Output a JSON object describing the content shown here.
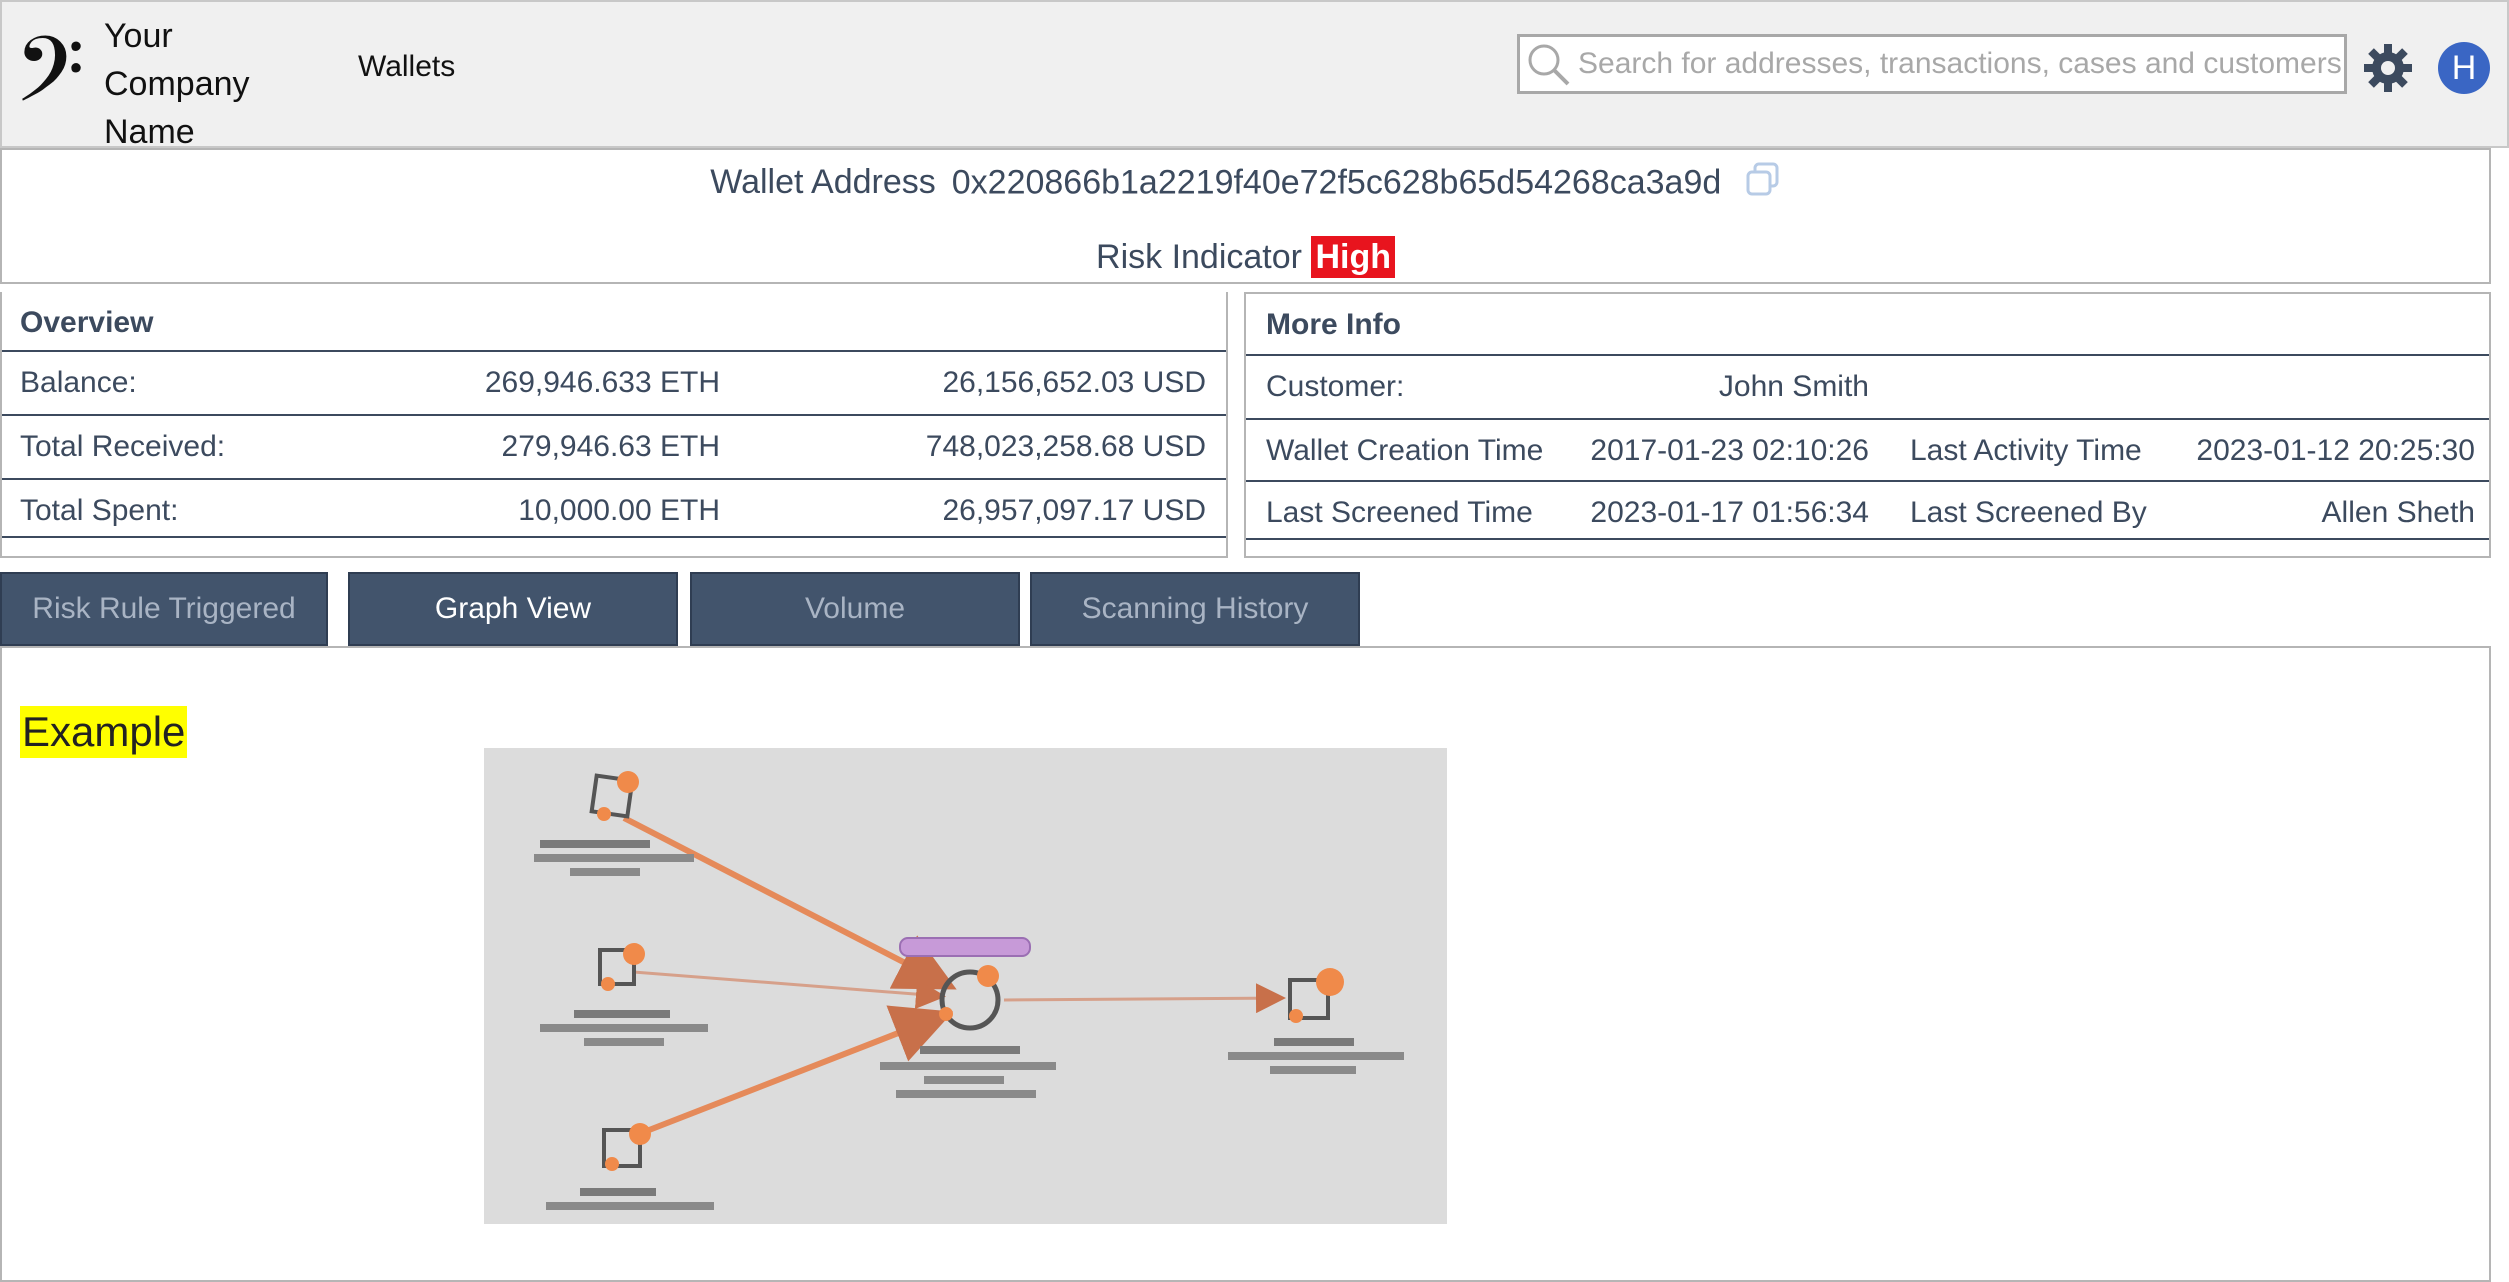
{
  "header": {
    "company_name": "Your Company Name",
    "nav_wallets": "Wallets",
    "search_placeholder": "Search for addresses, transactions, cases and customers...",
    "avatar_initial": "H"
  },
  "wallet": {
    "address_label": "Wallet Address",
    "address": "0x220866b1a2219f40e72f5c628b65d54268ca3a9d",
    "risk_label": "Risk Indicator",
    "risk_value": "High",
    "risk_color": "#e8141e"
  },
  "overview": {
    "title": "Overview",
    "rows": [
      {
        "label": "Balance:",
        "eth": "269,946.633 ETH",
        "usd": "26,156,652.03 USD"
      },
      {
        "label": "Total Received:",
        "eth": "279,946.63 ETH",
        "usd": "748,023,258.68 USD"
      },
      {
        "label": "Total Spent:",
        "eth": "10,000.00 ETH",
        "usd": "26,957,097.17 USD"
      }
    ]
  },
  "more_info": {
    "title": "More Info",
    "customer_label": "Customer:",
    "customer_value": "John Smith",
    "creation_label": "Wallet Creation Time",
    "creation_value": "2017-01-23 02:10:26",
    "last_activity_label": "Last Activity Time",
    "last_activity_value": "2023-01-12 20:25:30",
    "screened_label": "Last Screened Time",
    "screened_value": "2023-01-17 01:56:34",
    "screened_by_label": "Last Screened By",
    "screened_by_value": "Allen Sheth"
  },
  "tabs": [
    {
      "label": "Risk Rule Triggered",
      "active": false
    },
    {
      "label": "Graph View",
      "active": true
    },
    {
      "label": "Volume",
      "active": false
    },
    {
      "label": "Scanning History",
      "active": false
    }
  ],
  "content": {
    "example_label": "Example"
  },
  "colors": {
    "tab_bg": "#42546c",
    "highlight": "#ffff00",
    "avatar": "#3a66c4"
  }
}
